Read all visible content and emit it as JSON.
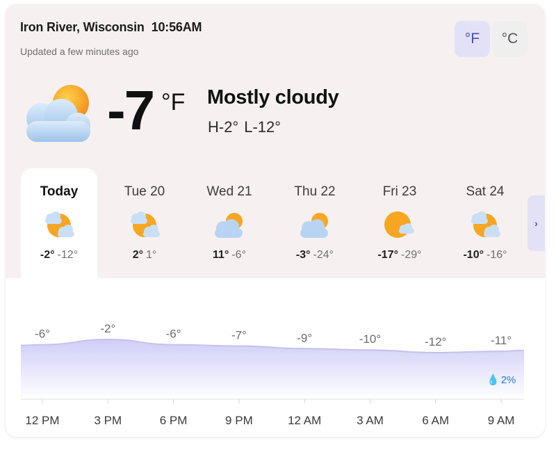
{
  "header": {
    "location": "Iron River, Wisconsin",
    "time": "10:56AM",
    "updated": "Updated a few minutes ago"
  },
  "units": {
    "fahrenheit": "°F",
    "celsius": "°C",
    "active": "fahrenheit"
  },
  "current": {
    "icon": "sun-behind-cloud-icon",
    "temp": "-7",
    "unit": "°F",
    "condition": "Mostly cloudy",
    "high": "H-2°",
    "low": "L-12°"
  },
  "forecast": [
    {
      "name": "Today",
      "icon": "partly-sunny-icon",
      "hi": "-2°",
      "lo": "-12°",
      "selected": true
    },
    {
      "name": "Tue 20",
      "icon": "partly-sunny-icon",
      "hi": "2°",
      "lo": "1°",
      "selected": false
    },
    {
      "name": "Wed 21",
      "icon": "mostly-cloudy-icon",
      "hi": "11°",
      "lo": "-6°",
      "selected": false
    },
    {
      "name": "Thu 22",
      "icon": "mostly-cloudy-icon",
      "hi": "-3°",
      "lo": "-24°",
      "selected": false
    },
    {
      "name": "Fri 23",
      "icon": "mostly-sunny-icon",
      "hi": "-17°",
      "lo": "-29°",
      "selected": false
    },
    {
      "name": "Sat 24",
      "icon": "partly-sunny-icon",
      "hi": "-10°",
      "lo": "-16°",
      "selected": false
    }
  ],
  "next_icon": "chevron-right-icon",
  "chart_data": {
    "type": "area",
    "x": [
      "12 PM",
      "3 PM",
      "6 PM",
      "9 PM",
      "12 AM",
      "3 AM",
      "6 AM",
      "9 AM"
    ],
    "values": [
      -6,
      -2,
      -6,
      -7,
      -9,
      -10,
      -12,
      -11
    ],
    "labels": [
      "-6°",
      "-2°",
      "-6°",
      "-7°",
      "-9°",
      "-10°",
      "-12°",
      "-11°"
    ],
    "grid": false,
    "precip_label": "2%"
  },
  "colors": {
    "card_bg": "#f6f1f0",
    "accent": "#4a4fb5",
    "toggle_active_bg": "#e3e1f6",
    "area_top": "#cfcdf6",
    "precip": "#2b7bd6"
  }
}
